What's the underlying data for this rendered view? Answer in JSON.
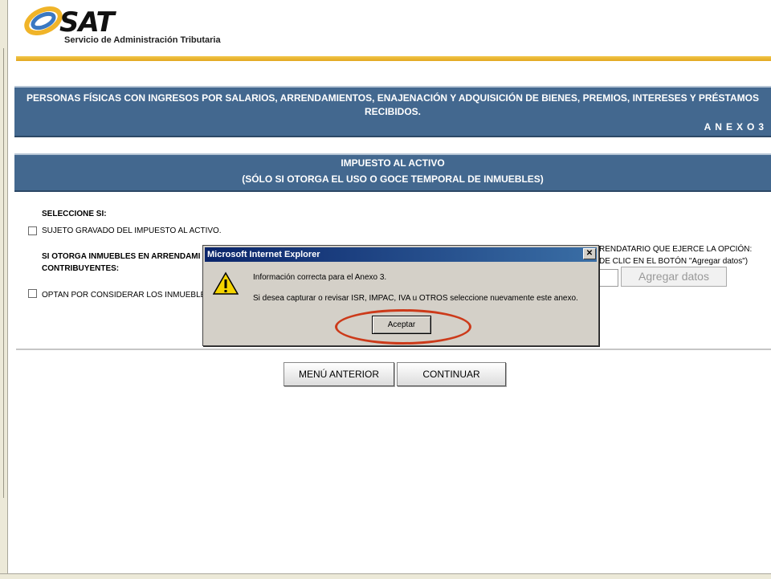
{
  "logo": {
    "brand": "SAT",
    "tagline": "Servicio de Administración Tributaria"
  },
  "banner1": {
    "title": "PERSONAS FÍSICAS CON INGRESOS POR SALARIOS, ARRENDAMIENTOS, ENAJENACIÓN Y ADQUISICIÓN DE BIENES, PREMIOS, INTERESES Y PRÉSTAMOS RECIBIDOS.",
    "anexo": "ANEXO3"
  },
  "banner2": {
    "line1": "IMPUESTO AL ACTIVO",
    "line2": "(SÓLO SI OTORGA EL USO O GOCE TEMPORAL DE INMUEBLES)"
  },
  "form": {
    "select_label": "SELECCIONE SI:",
    "option1": "SUJETO GRAVADO DEL IMPUESTO AL ACTIVO.",
    "q_line1": "SI OTORGA INMUEBLES EN ARRENDAMI",
    "q_line2": "CONTRIBUYENTES:",
    "right_line1": "RENDATARIO QUE EJERCE LA OPCIÓN:",
    "right_line2": "DE CLIC EN EL BOTÓN \"Agregar datos\")",
    "option2": "OPTAN POR CONSIDERAR LOS INMUEBLES",
    "agregar": "Agregar datos"
  },
  "buttons": {
    "menu_anterior": "MENÚ ANTERIOR",
    "continuar": "CONTINUAR"
  },
  "dialog": {
    "title": "Microsoft Internet Explorer",
    "close": "✕",
    "message1": "Información correcta para el Anexo 3.",
    "message2": "Si desea capturar o revisar ISR, IMPAC, IVA u OTROS seleccione nuevamente este anexo.",
    "ok": "Aceptar"
  },
  "colors": {
    "banner": "#43688f",
    "gold": "#e8b830",
    "highlight": "#cc3a1a",
    "titlebar": "#0a246a"
  },
  "icons": {
    "warning": "warning-icon",
    "close": "close-icon",
    "logo": "sat-logo"
  }
}
